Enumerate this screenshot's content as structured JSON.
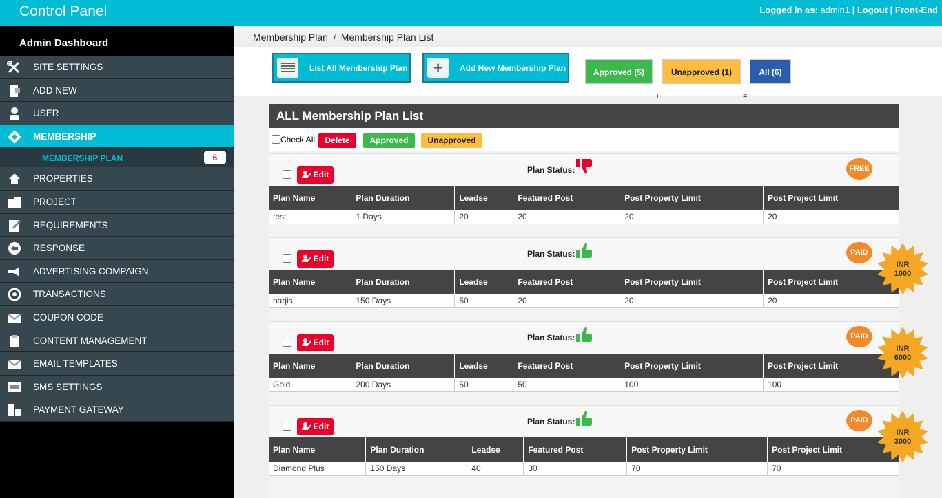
{
  "header": {
    "title": "Control Panel",
    "logged_in_label": "Logged in as:",
    "username": "admin1",
    "logout": "Logout",
    "frontend": "Front-End"
  },
  "sidebar": {
    "title": "Admin Dashboard",
    "items": [
      {
        "label": "SITE SETTINGS",
        "icon": "tools-icon"
      },
      {
        "label": "ADD NEW",
        "icon": "add-new-icon"
      },
      {
        "label": "USER",
        "icon": "user-icon"
      },
      {
        "label": "MEMBERSHIP",
        "icon": "membership-icon"
      },
      {
        "label": "PROPERTIES",
        "icon": "home-icon"
      },
      {
        "label": "PROJECT",
        "icon": "building-icon"
      },
      {
        "label": "REQUIREMENTS",
        "icon": "requirements-icon"
      },
      {
        "label": "RESPONSE",
        "icon": "reply-icon"
      },
      {
        "label": "ADVERTISING COMPAIGN",
        "icon": "megaphone-icon"
      },
      {
        "label": "TRANSACTIONS",
        "icon": "transactions-icon"
      },
      {
        "label": "COUPON CODE",
        "icon": "coupon-icon"
      },
      {
        "label": "CONTENT MANAGEMENT",
        "icon": "clipboard-icon"
      },
      {
        "label": "EMAIL TEMPLATES",
        "icon": "email-icon"
      },
      {
        "label": "SMS SETTINGS",
        "icon": "sms-icon"
      },
      {
        "label": "PAYMENT GATEWAY",
        "icon": "payment-icon"
      }
    ],
    "sub_item": {
      "label": "MEMBERSHIP PLAN",
      "count": "6"
    }
  },
  "breadcrumb": {
    "parent": "Membership Plan",
    "sep": "/",
    "current": "Membership Plan List"
  },
  "toolbar": {
    "list_all": "List All Membership Plan",
    "add_new": "Add New Membership Plan",
    "approved": "Approved (5)",
    "plus": "+",
    "unapproved": "Unapproved (1)",
    "equals": "=",
    "all": "All (6)"
  },
  "panel": {
    "title": "ALL Membership Plan List",
    "check_all": "Check All",
    "delete": "Delete",
    "approved": "Approved",
    "unapproved": "Unapproved",
    "edit": "Edit",
    "plan_status": "Plan Status:",
    "columns": [
      "Plan Name",
      "Plan Duration",
      "Leadse",
      "Featured Post",
      "Post Property Limit",
      "Post Project Limit"
    ]
  },
  "plans": [
    {
      "name": "test",
      "duration": "1 Days",
      "leads": "20",
      "featured": "20",
      "property_limit": "20",
      "project_limit": "20",
      "type": "FREE",
      "approved": false,
      "price_line1": "",
      "price_line2": ""
    },
    {
      "name": "narjis",
      "duration": "150 Days",
      "leads": "50",
      "featured": "20",
      "property_limit": "20",
      "project_limit": "20",
      "type": "PAID",
      "approved": true,
      "price_line1": "INR",
      "price_line2": "1000"
    },
    {
      "name": "Gold",
      "duration": "200 Days",
      "leads": "50",
      "featured": "50",
      "property_limit": "100",
      "project_limit": "100",
      "type": "PAID",
      "approved": true,
      "price_line1": "INR",
      "price_line2": "6000"
    },
    {
      "name": "Diamond Plus",
      "duration": "150 Days",
      "leads": "40",
      "featured": "30",
      "property_limit": "70",
      "project_limit": "70",
      "type": "PAID",
      "approved": true,
      "price_line1": "INR",
      "price_line2": "3000"
    }
  ],
  "colors": {
    "accent": "#00bcd4",
    "sidebar": "#37474f",
    "approved": "#3cb94a",
    "unapproved": "#fdbd3f",
    "all": "#2a5db0",
    "danger": "#e9002b",
    "badge": "#f28a2a",
    "star": "#f5a623"
  }
}
